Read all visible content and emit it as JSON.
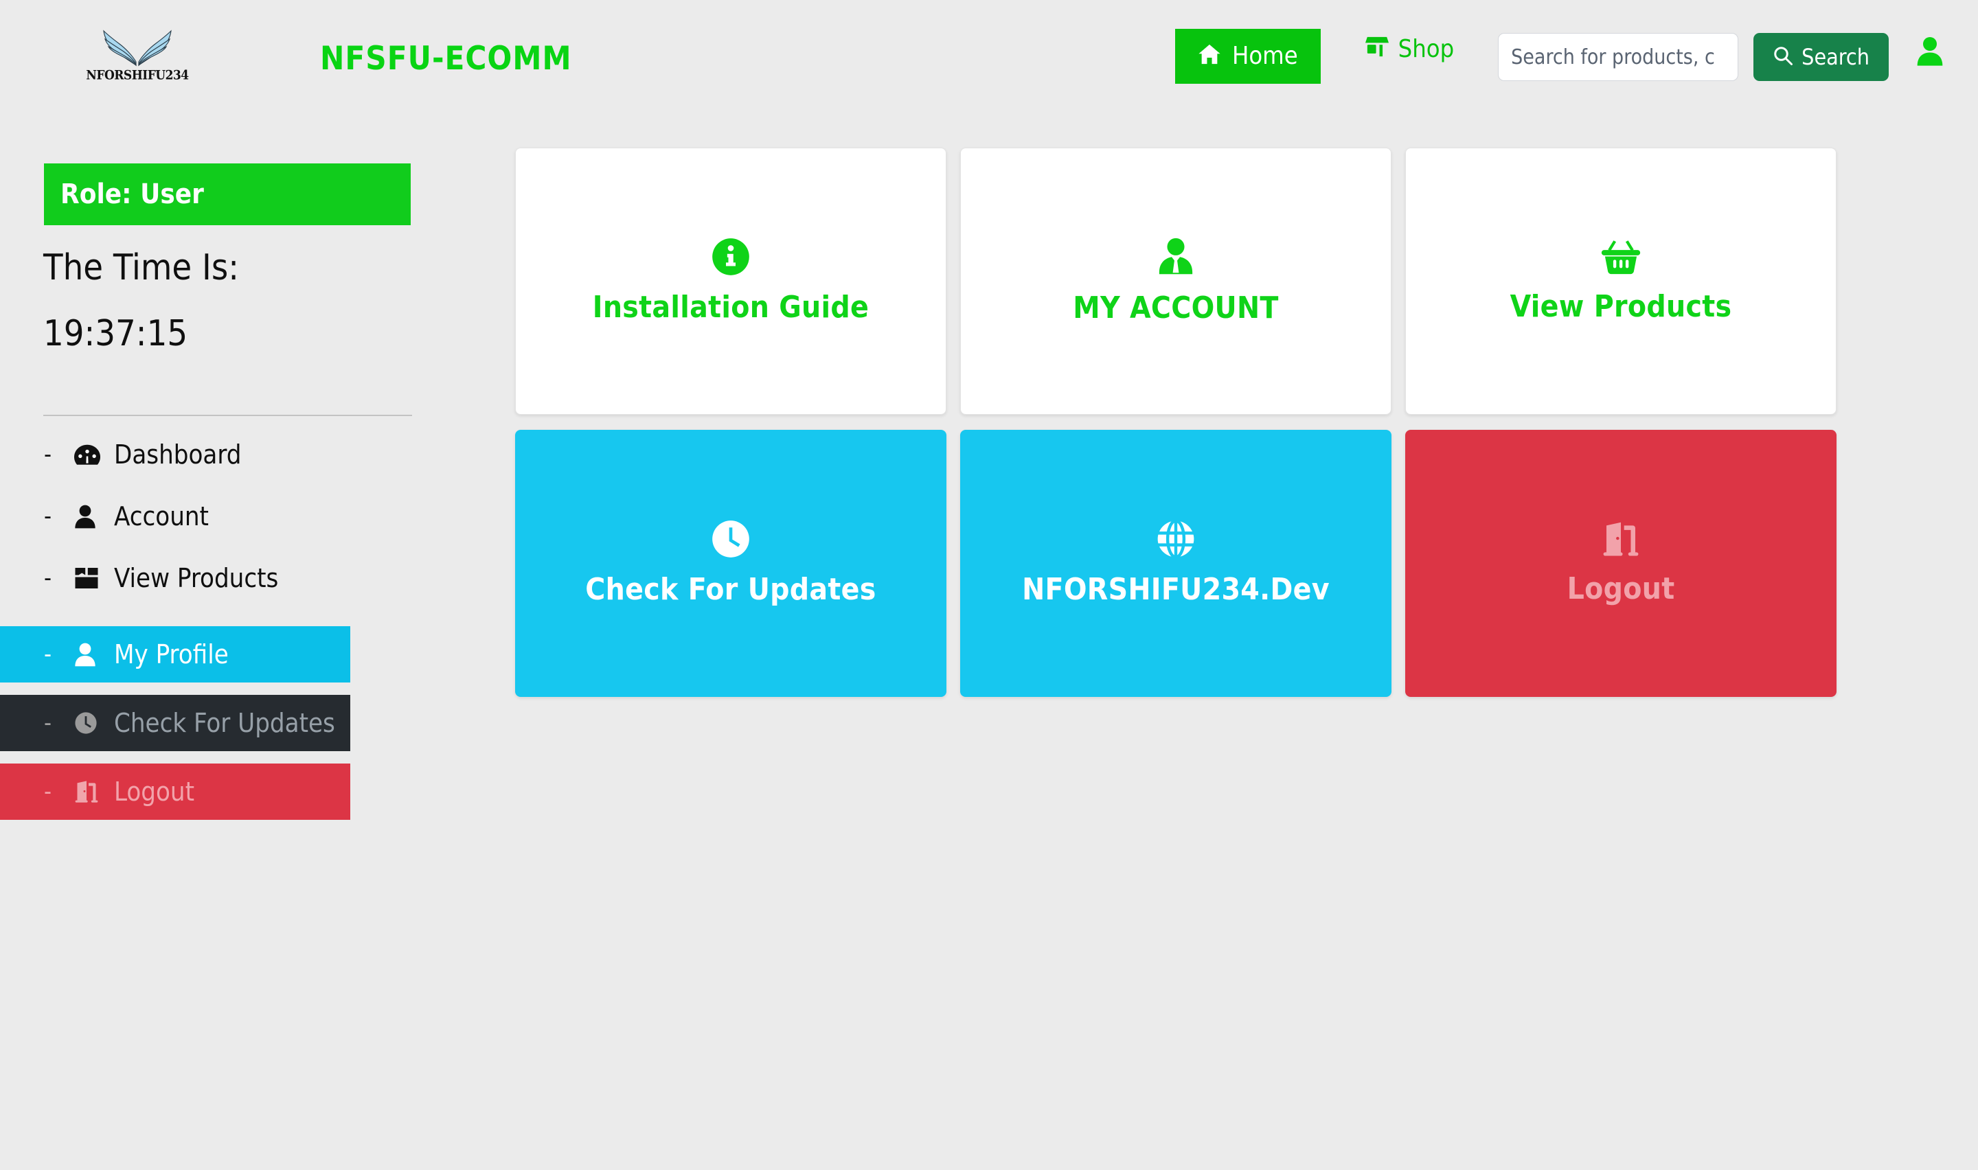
{
  "brand": {
    "logo_text": "NFORSHIFU234",
    "logo_icon": "wings-icon",
    "title": "NFSFU-ECOMM"
  },
  "topnav": {
    "home_label": "Home",
    "home_icon": "home-icon",
    "shop_label": "Shop",
    "shop_icon": "store-icon",
    "search_placeholder": "Search for products, c",
    "search_value": "",
    "search_button_label": "Search",
    "search_button_icon": "search-icon",
    "account_icon": "user-icon"
  },
  "sidebar": {
    "role_badge": "Role: User",
    "time_label": "The Time Is:",
    "time_value": "19:37:15",
    "items": [
      {
        "dash": "-",
        "icon": "tachometer-icon",
        "label": "Dashboard",
        "state": "plain"
      },
      {
        "dash": "-",
        "icon": "user-icon",
        "label": "Account",
        "state": "plain"
      },
      {
        "dash": "-",
        "icon": "box-icon",
        "label": "View Products",
        "state": "plain"
      },
      {
        "dash": "-",
        "icon": "user-icon",
        "label": "My Profile",
        "state": "highlight-cyan"
      },
      {
        "dash": "-",
        "icon": "clock-icon",
        "label": "Check For Updates",
        "state": "highlight-dark"
      },
      {
        "dash": "-",
        "icon": "door-open-icon",
        "label": "Logout",
        "state": "highlight-red"
      }
    ]
  },
  "cards": [
    {
      "label": "Installation Guide",
      "icon": "info-circle-icon",
      "style": "white"
    },
    {
      "label": "MY ACCOUNT",
      "icon": "user-tie-icon",
      "style": "white"
    },
    {
      "label": "View Products",
      "icon": "shopping-basket-icon",
      "style": "white"
    },
    {
      "label": "Check For Updates",
      "icon": "clock-icon",
      "style": "cyan"
    },
    {
      "label": "NFORSHIFU234.Dev",
      "icon": "globe-icon",
      "style": "cyan"
    },
    {
      "label": "Logout",
      "icon": "door-open-icon",
      "style": "red"
    }
  ],
  "colors": {
    "page_bg": "#ebebeb",
    "brand_green": "#09d413",
    "nav_green": "#07c30d",
    "badge_green": "#11cc1c",
    "search_green": "#17824a",
    "cyan": "#17c7ef",
    "sidebar_cyan": "#0bbfe8",
    "red": "#dc3545",
    "dark": "#262b30",
    "card_green_text": "#0fd318",
    "logout_text": "#f2a2aa"
  }
}
